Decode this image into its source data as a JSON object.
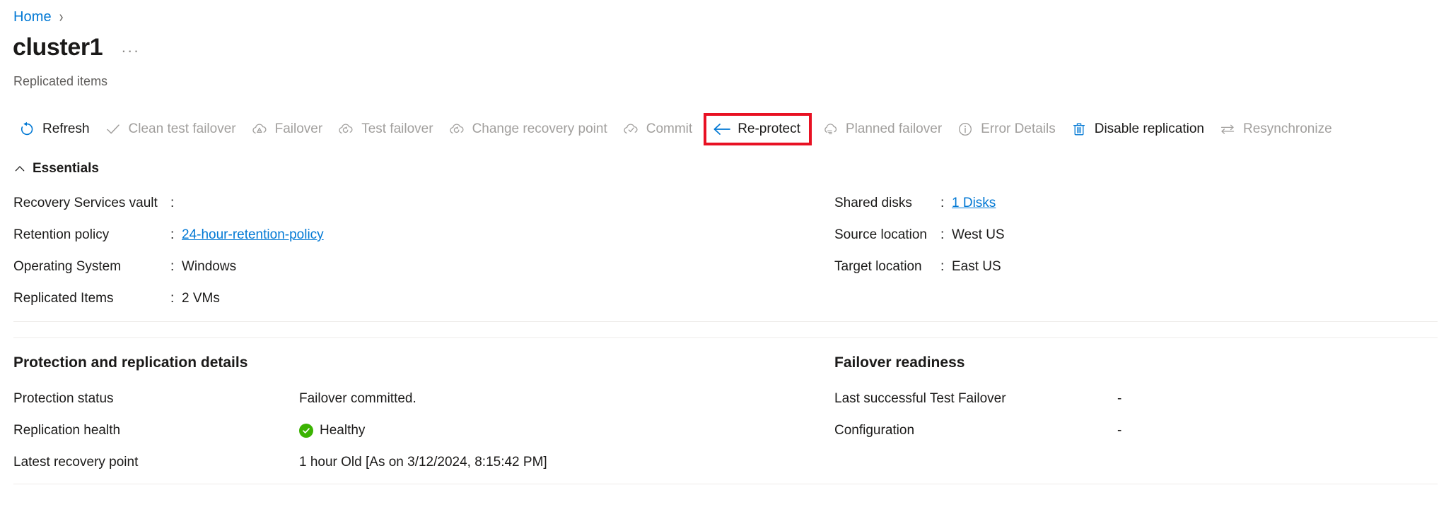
{
  "breadcrumb": {
    "home_label": "Home",
    "separator": "›"
  },
  "header": {
    "title": "cluster1",
    "ellipsis": "···",
    "subtitle": "Replicated items"
  },
  "toolbar": {
    "items": [
      {
        "label": "Refresh",
        "icon": "refresh-icon",
        "disabled": false,
        "highlighted": false
      },
      {
        "label": "Clean test failover",
        "icon": "checkmark-icon",
        "disabled": true,
        "highlighted": false
      },
      {
        "label": "Failover",
        "icon": "cloud-failover-icon",
        "disabled": true,
        "highlighted": false
      },
      {
        "label": "Test failover",
        "icon": "cloud-test-failover-icon",
        "disabled": true,
        "highlighted": false
      },
      {
        "label": "Change recovery point",
        "icon": "cloud-recovery-point-icon",
        "disabled": true,
        "highlighted": false
      },
      {
        "label": "Commit",
        "icon": "cloud-commit-icon",
        "disabled": true,
        "highlighted": false
      },
      {
        "label": "Re-protect",
        "icon": "arrow-left-icon",
        "disabled": false,
        "highlighted": true
      },
      {
        "label": "Planned failover",
        "icon": "cloud-planned-icon",
        "disabled": true,
        "highlighted": false
      },
      {
        "label": "Error Details",
        "icon": "info-circle-icon",
        "disabled": true,
        "highlighted": false
      },
      {
        "label": "Disable replication",
        "icon": "trash-icon",
        "disabled": false,
        "highlighted": false
      },
      {
        "label": "Resynchronize",
        "icon": "resync-arrows-icon",
        "disabled": true,
        "highlighted": false
      }
    ],
    "highlight_color": "#e81123"
  },
  "essentials": {
    "heading": "Essentials",
    "collapse_icon": "chevron-up-icon",
    "left": [
      {
        "key": "Recovery Services vault",
        "colon": ":",
        "value": "",
        "link": false
      },
      {
        "key": "Retention policy",
        "colon": ":",
        "value": "24-hour-retention-policy",
        "link": true
      },
      {
        "key": "Operating System",
        "colon": ":",
        "value": "Windows",
        "link": false
      },
      {
        "key": "Replicated Items",
        "colon": ":",
        "value": "2 VMs",
        "link": false
      }
    ],
    "right": [
      {
        "key": "Shared disks",
        "colon": ":",
        "value": "1 Disks",
        "link": true
      },
      {
        "key": "Source location",
        "colon": ":",
        "value": "West US",
        "link": false
      },
      {
        "key": "Target location",
        "colon": ":",
        "value": "East US",
        "link": false
      }
    ]
  },
  "protection_section": {
    "title": "Protection and replication details",
    "rows": [
      {
        "key": "Protection status",
        "value": "Failover committed.",
        "badge": false
      },
      {
        "key": "Replication health",
        "value": "Healthy",
        "badge": true
      },
      {
        "key": "Latest recovery point",
        "value": "1 hour Old [As on 3/12/2024, 8:15:42 PM]",
        "badge": false
      }
    ],
    "badge_color": "#3bb302"
  },
  "failover_section": {
    "title": "Failover readiness",
    "rows": [
      {
        "key": "Last successful Test Failover",
        "value": "-"
      },
      {
        "key": "Configuration",
        "value": "-"
      }
    ]
  },
  "colors": {
    "link": "#0078d4",
    "text": "#1b1a19",
    "muted": "#605e5c",
    "disabled": "#a19f9d",
    "divider": "#edebe9"
  }
}
